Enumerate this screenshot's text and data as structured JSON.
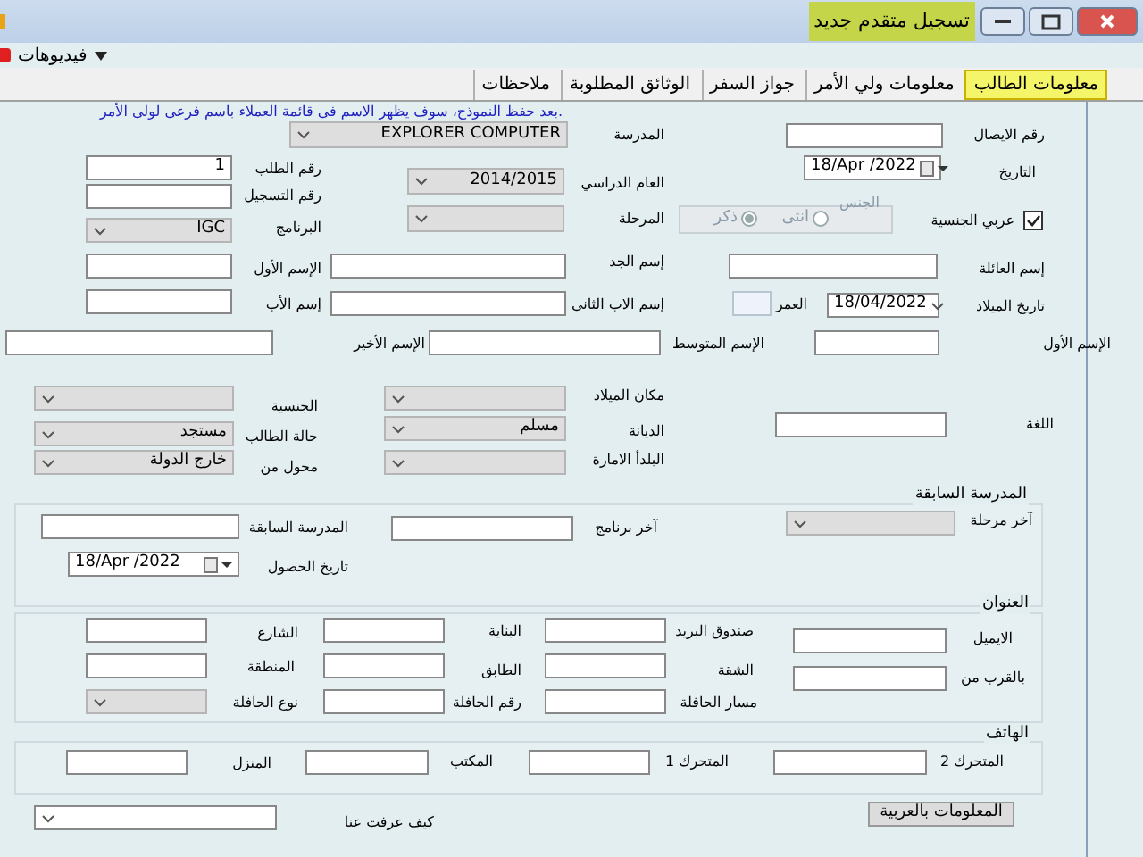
{
  "window": {
    "title": "تسجيل متقدم جديد"
  },
  "toolbar": {
    "menu_label": "فيديوهات"
  },
  "tabs": [
    {
      "label": "معلومات الطالب",
      "selected": true
    },
    {
      "label": "معلومات ولي الأمر",
      "selected": false
    },
    {
      "label": "جواز السفر",
      "selected": false
    },
    {
      "label": "الوثائق المطلوبة",
      "selected": false
    },
    {
      "label": "ملاحظات",
      "selected": false
    }
  ],
  "note": "بعد حفظ النموذج، سوف يظهر الاسم فى قائمة العملاء باسم فرعى لولى الأمر.",
  "fields": [
    {
      "label": "رقم الايصال",
      "kind": "text"
    },
    {
      "label": "المدرسة",
      "kind": "combo",
      "value": "EXPLORER COMPUTER",
      "disabled": true
    },
    {
      "label": "التاريخ",
      "kind": "date",
      "value": "18/Apr /2022"
    },
    {
      "label": "رقم الطلب",
      "kind": "text",
      "value": "1"
    },
    {
      "label": "العام الدراسي",
      "kind": "combo",
      "value": "2014/2015",
      "disabled": true
    },
    {
      "label": "رقم التسجيل",
      "kind": "text"
    },
    {
      "label": "عربي الجنسية",
      "kind": "checkbox",
      "checked": true
    },
    {
      "label": "الجنس",
      "kind": "radio_group",
      "disabled": true,
      "options": [
        {
          "label": "انثى",
          "selected": false
        },
        {
          "label": "ذكر",
          "selected": true
        }
      ]
    },
    {
      "label": "المرحلة",
      "kind": "combo",
      "disabled": true
    },
    {
      "label": "البرنامج",
      "kind": "combo",
      "value": "IGC",
      "disabled": true
    },
    {
      "label": "إسم العائلة",
      "kind": "text"
    },
    {
      "label": "إسم الجد",
      "kind": "text"
    },
    {
      "label": "الإسم الأول",
      "kind": "text"
    },
    {
      "label": "تاريخ الميلاد",
      "kind": "combo",
      "value": "18/04/2022",
      "disabled": false
    },
    {
      "label": "العمر",
      "kind": "readonly"
    },
    {
      "label": "إسم الاب الثانى",
      "kind": "text"
    },
    {
      "label": "إسم الأب",
      "kind": "text"
    },
    {
      "label": "الإسم الأول",
      "kind": "text"
    },
    {
      "label": "الإسم المتوسط",
      "kind": "text"
    },
    {
      "label": "الإسم الأخير",
      "kind": "text"
    },
    {
      "label": "مكان الميلاد",
      "kind": "combo",
      "disabled": true
    },
    {
      "label": "الجنسية",
      "kind": "combo",
      "disabled": true
    },
    {
      "label": "اللغة",
      "kind": "text"
    },
    {
      "label": "الديانة",
      "kind": "combo",
      "value": "مسلم",
      "disabled": true
    },
    {
      "label": "حالة الطالب",
      "kind": "combo",
      "value": "مستجد",
      "disabled": true
    },
    {
      "label": "البلدأ الامارة",
      "kind": "combo",
      "disabled": true
    },
    {
      "label": "محول من",
      "kind": "combo",
      "value": "خارج الدولة",
      "disabled": true
    }
  ],
  "groups": [
    {
      "title": "المدرسة السابقة",
      "fields": [
        {
          "label": "آخر مرحلة",
          "kind": "combo",
          "disabled": true
        },
        {
          "label": "آخر برنامج",
          "kind": "text"
        },
        {
          "label": "المدرسة السابقة",
          "kind": "text"
        },
        {
          "label": "تاريخ الحصول",
          "kind": "date",
          "value": "18/Apr /2022"
        }
      ]
    },
    {
      "title": "العنوان",
      "fields": [
        {
          "label": "الايميل",
          "kind": "text"
        },
        {
          "label": "صندوق البريد",
          "kind": "text"
        },
        {
          "label": "البناية",
          "kind": "text"
        },
        {
          "label": "الشارع",
          "kind": "text"
        },
        {
          "label": "بالقرب من",
          "kind": "text"
        },
        {
          "label": "الشقة",
          "kind": "text"
        },
        {
          "label": "الطابق",
          "kind": "text"
        },
        {
          "label": "المنطقة",
          "kind": "text"
        },
        {
          "label": "مسار الحافلة",
          "kind": "text"
        },
        {
          "label": "رقم الحافلة",
          "kind": "text"
        },
        {
          "label": "نوع الحافلة",
          "kind": "combo",
          "disabled": true
        }
      ]
    },
    {
      "title": "الهاتف",
      "fields": [
        {
          "label": "المتحرك 2",
          "kind": "text"
        },
        {
          "label": "المتحرك 1",
          "kind": "text"
        },
        {
          "label": "المكتب",
          "kind": "text"
        },
        {
          "label": "المنزل",
          "kind": "text"
        }
      ]
    }
  ],
  "footer": {
    "button": "المعلومات بالعربية",
    "field": {
      "label": "كيف عرفت عنا",
      "kind": "combo",
      "disabled": false
    }
  }
}
